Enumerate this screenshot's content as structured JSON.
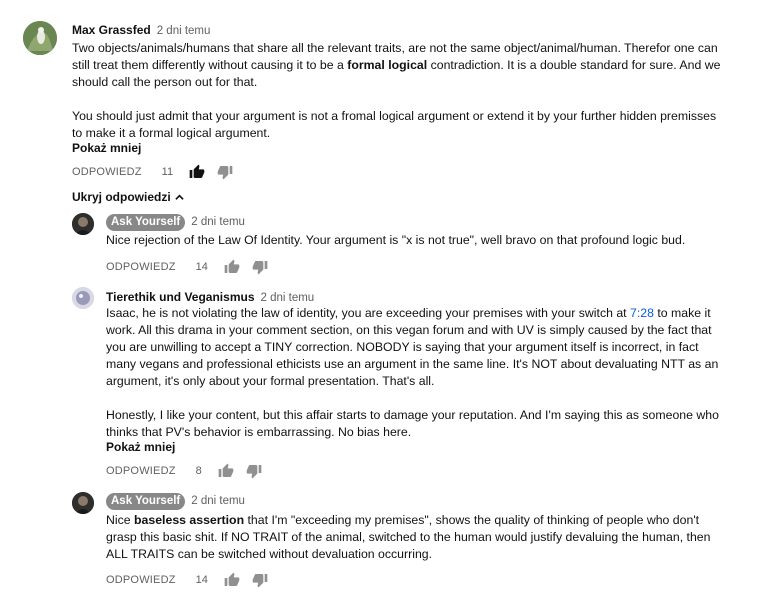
{
  "comment_main": {
    "author": "Max Grassfed",
    "time": "2 dni temu",
    "para1_a": "Two objects/animals/humans that share all the relevant traits, are not the same object/animal/human. Therefor one can still treat them differently without causing it to be a ",
    "para1_bold": "formal logical",
    "para1_b": " contradiction. It is a double standard for sure. And we should call the person out for that.",
    "para2": "You should just admit that your argument is not a fromal logical argument or extend it by your further hidden premisses to make it a formal logical argument.",
    "show_less": "Pokaż mniej",
    "reply_label": "ODPOWIEDZ",
    "likes": "11"
  },
  "hide_replies": "Ukryj odpowiedzi",
  "reply1": {
    "author": "Ask Yourself",
    "time": "2 dni temu",
    "text": "Nice rejection of the Law Of Identity.  Your argument is \"x is not true\", well bravo on that profound logic bud.",
    "reply_label": "ODPOWIEDZ",
    "likes": "14"
  },
  "reply2": {
    "author": "Tierethik und Veganismus",
    "time": "2 dni temu",
    "para1_a": "Isaac, he is not violating the law of identity, you are exceeding your premises with your switch at ",
    "timestamp": "7:28",
    "para1_b": " to make it work. All this drama in your comment section, on this vegan forum and with UV is simply caused by the fact that you are unwilling to accept a TINY correction. NOBODY is saying that your argument itself is incorrect, in fact many vegans and professional ethicists use an argument in the same line. It's NOT about devaluating NTT as an argument, it's only about your formal presentation. That's all.",
    "para2": "Honestly, I like your content, but this affair starts to damage your reputation. And I'm saying this as someone who thinks that PV's behavior is embarrassing. No bias here.",
    "show_less": "Pokaż mniej",
    "reply_label": "ODPOWIEDZ",
    "likes": "8"
  },
  "reply3": {
    "author": "Ask Yourself",
    "time": "2 dni temu",
    "text_a": "Nice ",
    "text_bold": "baseless assertion",
    "text_b": " that I'm \"exceeding my premises\", shows the quality of thinking of people who don't grasp this basic shit.  If NO TRAIT of the animal, switched to the human would justify devaluing the human, then ALL TRAITS can be switched without devaluation occurring.",
    "reply_label": "ODPOWIEDZ",
    "likes": "14"
  },
  "icons": {
    "like": "thumbs-up-icon",
    "dislike": "thumbs-down-icon",
    "chevron": "chevron-up-icon"
  }
}
